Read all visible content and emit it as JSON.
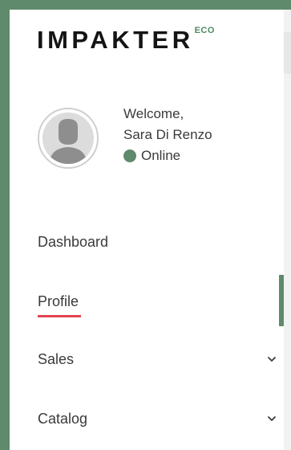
{
  "brand": {
    "name": "IMPAKTER",
    "superscript": "ECO",
    "accent_color": "#5f8a6c",
    "active_underline_color": "#e54551"
  },
  "user": {
    "greeting": "Welcome,",
    "name": "Sara Di Renzo",
    "status": "Online",
    "avatar_icon": "person-silhouette-icon"
  },
  "nav": {
    "items": [
      {
        "label": "Dashboard",
        "active": false,
        "expandable": false
      },
      {
        "label": "Profile",
        "active": true,
        "expandable": false
      },
      {
        "label": "Sales",
        "active": false,
        "expandable": true,
        "icon": "chevron-down-icon"
      },
      {
        "label": "Catalog",
        "active": false,
        "expandable": true,
        "icon": "chevron-down-icon"
      }
    ]
  }
}
